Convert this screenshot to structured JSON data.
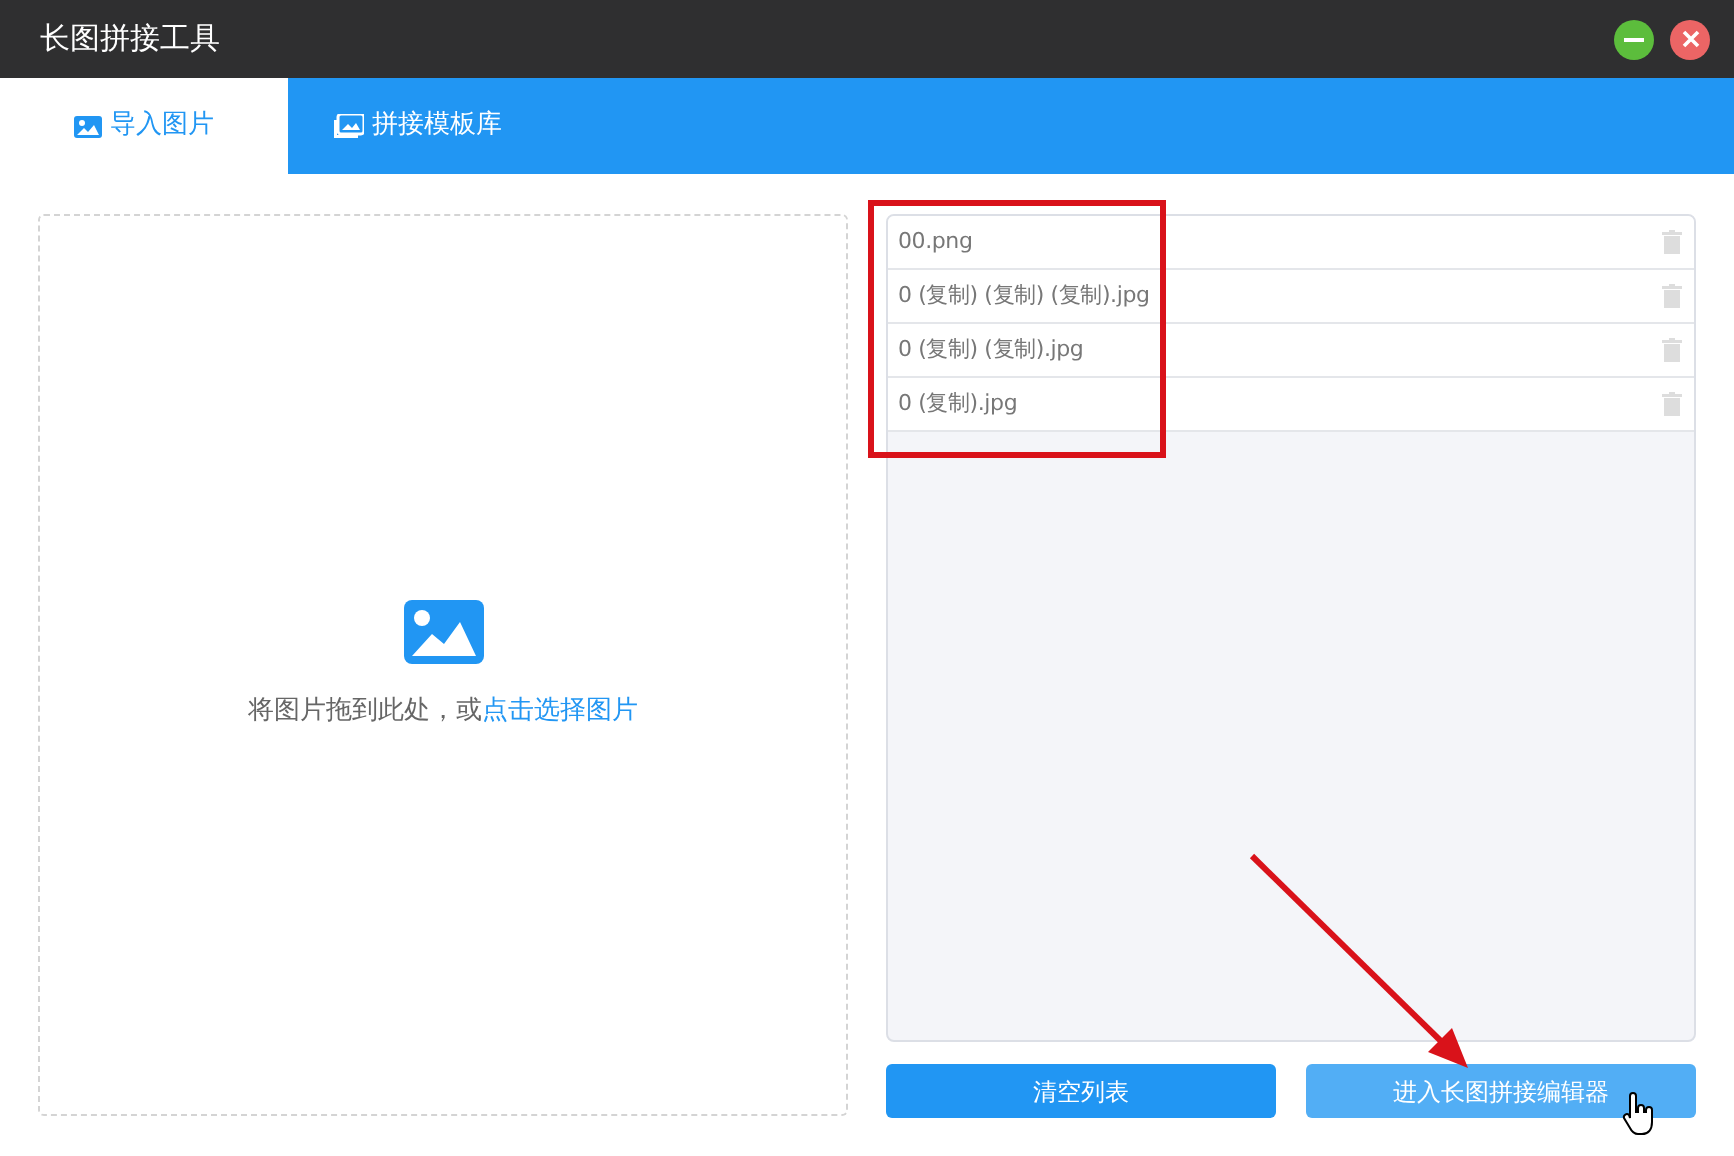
{
  "window": {
    "title": "长图拼接工具"
  },
  "tabs": [
    {
      "label": "导入图片",
      "selected": true
    },
    {
      "label": "拼接模板库",
      "selected": false
    }
  ],
  "drop_zone": {
    "text": "将图片拖到此处，或",
    "link": "点击选择图片"
  },
  "files": [
    {
      "name": "00.png"
    },
    {
      "name": "0 (复制) (复制) (复制).jpg"
    },
    {
      "name": "0 (复制) (复制).jpg"
    },
    {
      "name": "0 (复制).jpg"
    }
  ],
  "buttons": [
    {
      "label": "清空列表",
      "hovered": false
    },
    {
      "label": "进入长图拼接编辑器",
      "hovered": true
    }
  ]
}
